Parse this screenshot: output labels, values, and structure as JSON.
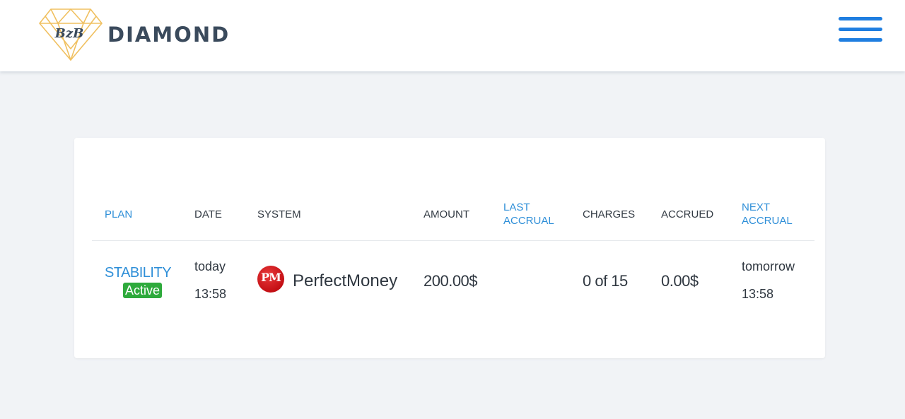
{
  "header": {
    "logo_monogram": "BzB",
    "brand": "DIAMOND",
    "menu_icon": "hamburger-menu-icon",
    "accent_color": "#1f7ee0"
  },
  "table": {
    "columns": [
      "PLAN",
      "DATE",
      "SYSTEM",
      "AMOUNT",
      "LAST\nACCRUAL",
      "CHARGES",
      "ACCRUED",
      "NEXT\nACCRUAL"
    ],
    "rows": [
      {
        "plan": "STABILITY",
        "status": "Active",
        "date_day": "today",
        "date_time": "13:58",
        "system_logo": "PM",
        "system": "PerfectMoney",
        "amount": "200.00$",
        "last_accrual": "",
        "charges": "0 of 15",
        "accrued": "0.00$",
        "next_day": "tomorrow",
        "next_time": "13:58"
      }
    ]
  },
  "colors": {
    "link_blue": "#2f8fd8",
    "active_green": "#2eaa3c",
    "background": "#f1f3f6"
  }
}
